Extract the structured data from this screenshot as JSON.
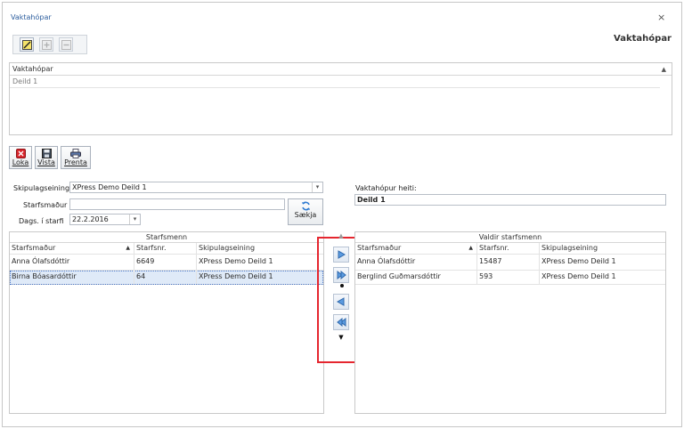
{
  "window": {
    "title": "Vaktahópar",
    "heading": "Vaktahópar",
    "close_glyph": "×"
  },
  "top_toolbar": {
    "icons": [
      "edit-icon",
      "add-icon",
      "remove-icon"
    ]
  },
  "groups_grid": {
    "column_header": "Vaktahópar",
    "rows": [
      "Deild 1"
    ]
  },
  "action_toolbar": {
    "close_label": "Loka",
    "save_label": "Vista",
    "print_label": "Prenta"
  },
  "filters": {
    "unit_label": "Skipulagseining",
    "unit_value": "XPress Demo Deild 1",
    "employee_label": "Starfsmaður",
    "employee_value": "",
    "date_label": "Dags. í starfi",
    "date_value": "22.2.2016",
    "fetch_label": "Sækja"
  },
  "group_name": {
    "label": "Vaktahópur heiti:",
    "value": "Deild 1"
  },
  "left_table": {
    "group_header": "Starfsmenn",
    "columns": [
      "Starfsmaður",
      "Starfsnr.",
      "Skipulagseining"
    ],
    "rows": [
      [
        "Anna Ólafsdóttir",
        "6649",
        "XPress Demo Deild 1"
      ],
      [
        "Birna Bóasardóttir",
        "64",
        "XPress Demo Deild 1"
      ]
    ]
  },
  "right_table": {
    "group_header": "Valdir starfsmenn",
    "columns": [
      "Starfsmaður",
      "Starfsnr.",
      "Skipulagseining"
    ],
    "rows": [
      [
        "Anna Ólafsdóttir",
        "15487",
        "XPress Demo Deild 1"
      ],
      [
        "Berglind Guðmarsdóttir",
        "593",
        "XPress Demo Deild 1"
      ]
    ]
  },
  "colors": {
    "accent": "#2d5e9e",
    "highlight_frame": "#e5262f",
    "selected_row": "#dfeaf8"
  }
}
